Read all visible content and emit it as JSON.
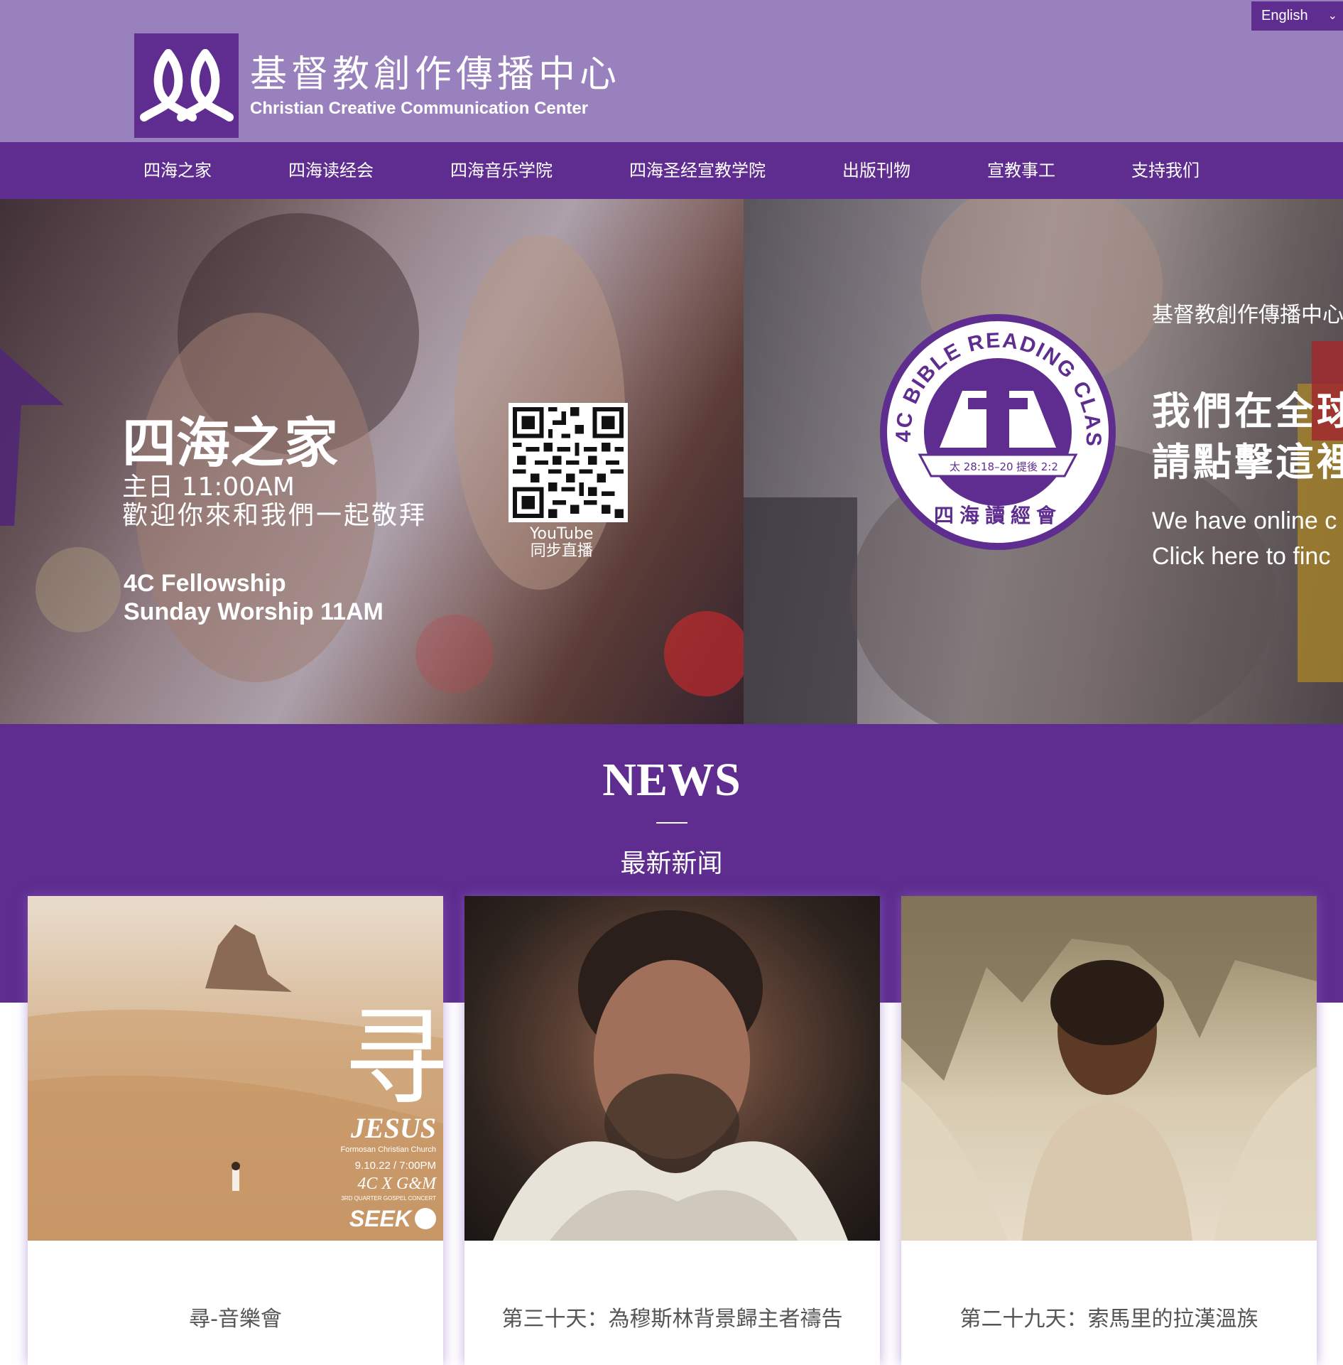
{
  "header": {
    "language": "English",
    "logo_title_zh": "基督教創作傳播中心",
    "logo_title_en": "Christian Creative Communication Center"
  },
  "nav": {
    "items": [
      "四海之家",
      "四海读经会",
      "四海音乐学院",
      "四海圣经宣教学院",
      "出版刊物",
      "宣教事工",
      "支持我们"
    ]
  },
  "hero": {
    "left": {
      "title": "四海之家",
      "time": "主日 11:00AM",
      "welcome": "歡迎你來和我們一起敬拜",
      "en_line1": "4C Fellowship",
      "en_line2": "Sunday Worship 11AM",
      "qr_label1": "YouTube",
      "qr_label2": "同步直播"
    },
    "right": {
      "badge_ring": "4C BIBLE READING CLASS",
      "badge_ref_left": "太 28:18–20",
      "badge_ref_right": "提後 2:2",
      "badge_bottom": "四海讀經會",
      "org": "基督教創作傳播中心",
      "line1": "我們在全球",
      "line2": "請點擊這裡",
      "en_line1": "We have online c",
      "en_line2": "Click here to finc"
    }
  },
  "news": {
    "title": "NEWS",
    "subtitle": "最新新闻",
    "cards": [
      {
        "title": "尋-音樂會",
        "poster": {
          "glyph": "寻",
          "jesus": "JESUS",
          "church": "Formosan Christian Church",
          "date": "9.10.22 / 7:00PM",
          "collab": "4C X G&M",
          "series": "3RD QUARTER GOSPEL CONCERT",
          "seek": "SEEK"
        }
      },
      {
        "title": "第三十天：為穆斯林背景歸主者禱告"
      },
      {
        "title": "第二十九天：索馬里的拉漢溫族"
      }
    ]
  },
  "colors": {
    "header_bg": "#9981bd",
    "brand_purple": "#5e2d8f"
  }
}
